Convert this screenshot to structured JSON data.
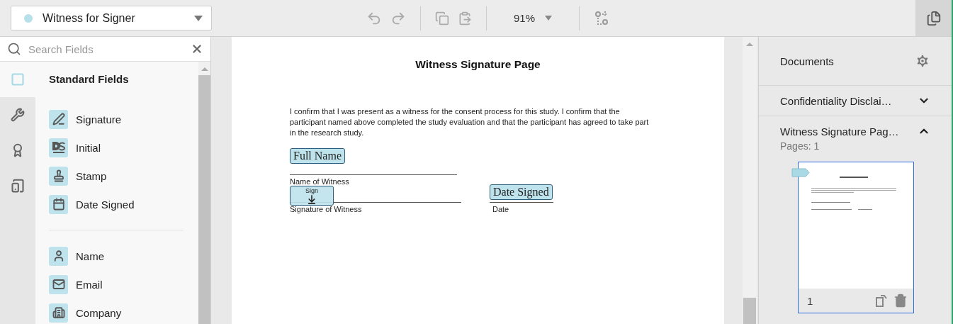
{
  "recipient": {
    "name": "Witness for Signer",
    "color": "#b7e0ea"
  },
  "toolbar": {
    "zoom": "91%"
  },
  "search": {
    "placeholder": "Search Fields"
  },
  "rail": [
    {
      "selected": true
    },
    {
      "selected": false
    },
    {
      "selected": false
    },
    {
      "selected": false
    }
  ],
  "field_groups": [
    {
      "title": "Standard Fields",
      "items": [
        "Signature",
        "Initial",
        "Stamp",
        "Date Signed"
      ]
    },
    {
      "items": [
        "Name",
        "Email",
        "Company"
      ]
    }
  ],
  "document": {
    "title": "Witness Signature Page",
    "paragraph": "I confirm that I was present as a witness for the consent process for this study.  I confirm that the participant named above completed the study evaluation and that the participant has agreed to take part in the research study.",
    "lines": [
      "Name of Witness",
      "Signature of Witness",
      "Date"
    ],
    "fields": [
      {
        "kind": "text",
        "label": "Full Name"
      },
      {
        "kind": "sign",
        "label": "Sign"
      },
      {
        "kind": "text",
        "label": "Date Signed"
      }
    ]
  },
  "documents": {
    "title": "Documents",
    "items": [
      {
        "name": "Confidentiality Disclai…",
        "expanded": false
      },
      {
        "name": "Witness Signature Pag…",
        "expanded": true,
        "pages": "Pages: 1",
        "thumbnail_page": "1"
      }
    ]
  }
}
